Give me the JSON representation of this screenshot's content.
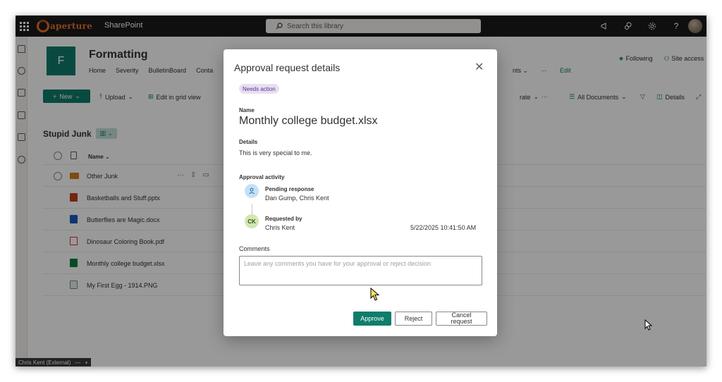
{
  "suitebar": {
    "logo_text": "aperture",
    "app_name": "SharePoint",
    "search_placeholder": "Search this library"
  },
  "site": {
    "logo_letter": "F",
    "title": "Formatting",
    "nav": [
      "Home",
      "Severity",
      "BulletinBoard",
      "Conta"
    ],
    "nav_right": [
      "nts ⌄",
      "···",
      "Edit"
    ],
    "following": "Following",
    "site_access": "Site access"
  },
  "commandbar": {
    "new": "New",
    "upload": "Upload",
    "edit_grid": "Edit in grid view",
    "automate": "rate",
    "more": "···",
    "view": "All Documents",
    "details": "Details"
  },
  "library": {
    "title": "Stupid Junk",
    "column_name": "Name",
    "rows": [
      {
        "name": "Other Junk",
        "type": "folder"
      },
      {
        "name": "Basketballs and Stuff.pptx",
        "type": "pptx"
      },
      {
        "name": "Butterflies are Magic.docx",
        "type": "docx"
      },
      {
        "name": "Dinosaur Coloring Book.pdf",
        "type": "pdf"
      },
      {
        "name": "Monthly college budget.xlsx",
        "type": "xlsx"
      },
      {
        "name": "My First Egg - 1914.PNG",
        "type": "png"
      }
    ]
  },
  "presence": {
    "label": "Chris Kent (External)",
    "minus": "—",
    "plus": "+"
  },
  "modal": {
    "title": "Approval request details",
    "status": "Needs action",
    "name_label": "Name",
    "file_name": "Monthly college budget.xlsx",
    "details_label": "Details",
    "details_text": "This is very special to me.",
    "activity_label": "Approval activity",
    "pending_heading": "Pending response",
    "pending_people": "Dan Gump, Chris Kent",
    "requested_heading": "Requested by",
    "requested_by": "Chris Kent",
    "requester_initials": "CK",
    "requested_date": "5/22/2025 10:41:50 AM",
    "comments_label": "Comments",
    "comments_placeholder": "Leave any comments you have for your approval or reject decision",
    "approve": "Approve",
    "reject": "Reject",
    "cancel_line1": "Cancel",
    "cancel_line2": "request"
  },
  "colors": {
    "brand": "#107c6c",
    "suitebar": "#1b1a19",
    "status_pill_bg": "#e8dff2",
    "status_pill_text": "#5c2e91"
  }
}
